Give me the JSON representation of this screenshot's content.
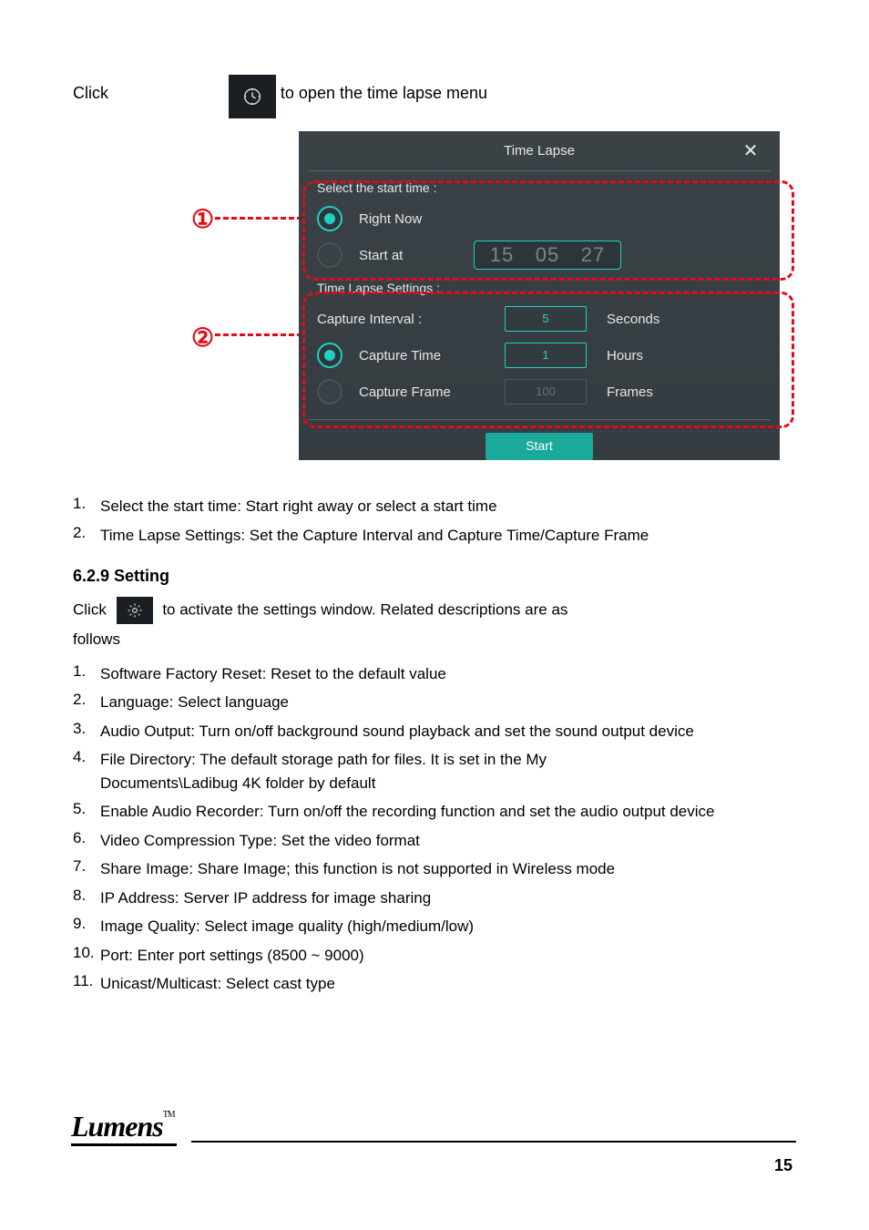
{
  "instr_click": "Click",
  "instr_after": "to open the time lapse menu",
  "dialog": {
    "title": "Time Lapse",
    "select_label": "Select the start time :",
    "right_now": "Right Now",
    "start_at": "Start at",
    "time_h": "15",
    "time_m": "05",
    "time_s": "27",
    "settings_label": "Time Lapse Settings :",
    "capture_interval_label": "Capture Interval :",
    "capture_interval_val": "5",
    "capture_interval_unit": "Seconds",
    "capture_time_label": "Capture Time",
    "capture_time_val": "1",
    "capture_time_unit": "Hours",
    "capture_frame_label": "Capture Frame",
    "capture_frame_val": "100",
    "capture_frame_unit": "Frames",
    "start_btn": "Start"
  },
  "callouts": {
    "one": "①",
    "two": "②"
  },
  "list": {
    "a_num": "1.",
    "a_txt": "Select the start time: Start right away or select a start time",
    "b_num": "2.",
    "b_txt": "Time Lapse Settings: Set the Capture Interval and Capture Time/Capture Frame"
  },
  "section": {
    "heading": "6.2.9 Setting",
    "p1": "Click",
    "p1b": "to activate the settings window. Related descriptions are as",
    "p2": "follows",
    "a_num": "1.",
    "a_txt": "Software Factory Reset: Reset to the default value",
    "b_num": "2.",
    "b_txt": "Language: Select language",
    "c_num": "3.",
    "c_txt": "Audio Output: Turn on/off background sound playback and set the sound output device",
    "d_num": "4.",
    "d_txt": "File Directory: The default storage path for files. It is set in the My",
    "d_txt2": "Documents\\Ladibug 4K folder by default",
    "e_num": "5.",
    "e_txt": "Enable Audio Recorder: Turn on/off the recording function and set the audio output device",
    "f_num": "6.",
    "f_txt": "Video Compression Type: Set the video format",
    "g_num": "7.",
    "g_txt": "Share Image: Share Image; this function is not supported in Wireless mode",
    "h_num": "8.",
    "h_txt": "IP Address: Server IP address for image sharing",
    "i_num": "9.",
    "i_txt": "Image Quality: Select image quality (high/medium/low)",
    "j_num": "10.",
    "j_txt": "Port: Enter port settings (8500 ~ 9000)",
    "k_num": "11.",
    "k_txt": "Unicast/Multicast: Select cast type"
  },
  "footer": {
    "brand": "Lumens",
    "tm": "TM",
    "pagenum": "15"
  }
}
